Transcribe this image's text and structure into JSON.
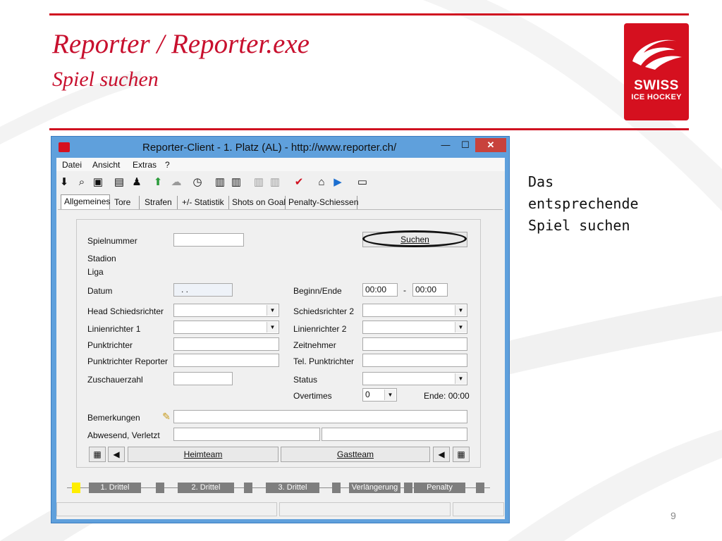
{
  "slide": {
    "title": "Reporter / Reporter.exe",
    "subtitle": "Spiel suchen",
    "note_lines": [
      "Das",
      "entsprechende",
      "Spiel suchen"
    ],
    "page_number": "9",
    "logo": {
      "line1": "SWISS",
      "line2": "ICE HOCKEY"
    },
    "accent_color": "#c8102e"
  },
  "window": {
    "title": "Reporter-Client  -  1. Platz (AL)  -  http://www.reporter.ch/",
    "controls": {
      "minimize": "—",
      "maximize": "☐",
      "close": "✕"
    }
  },
  "menu": [
    "Datei",
    "Ansicht",
    "Extras",
    "?"
  ],
  "toolbar_icons": [
    "download-icon",
    "search-icon",
    "save-icon",
    "clipboard-icon",
    "players-icon",
    "upload-icon",
    "cloud-icon",
    "stopwatch-icon",
    "lineup-icon",
    "lineup2-icon",
    "lineup-disabled-icon",
    "lineup2-disabled-icon",
    "checkmark-icon",
    "home-icon",
    "youtube-icon",
    "tv-icon"
  ],
  "tabs": [
    "Allgemeines",
    "Tore",
    "Strafen",
    "+/- Statistik",
    "Shots on Goal",
    "Penalty-Schiessen"
  ],
  "form": {
    "spielnummer_label": "Spielnummer",
    "spielnummer_value": "",
    "suchen_button": "Suchen",
    "stadion_label": "Stadion",
    "liga_label": "Liga",
    "datum_label": "Datum",
    "datum_value": ". .",
    "beginn_label": "Beginn/Ende",
    "beginn_value": "00:00",
    "range_sep": "-",
    "ende_value": "00:00",
    "head_label": "Head Schiedsrichter",
    "sr2_label": "Schiedsrichter 2",
    "lin1_label": "Linienrichter 1",
    "lin2_label": "Linienrichter 2",
    "punkt_label": "Punktrichter",
    "zeit_label": "Zeitnehmer",
    "punktrep_label": "Punktrichter Reporter",
    "tel_label": "Tel. Punktrichter",
    "zusch_label": "Zuschauerzahl",
    "status_label": "Status",
    "overtimes_label": "Overtimes",
    "overtimes_value": "0",
    "ende_label": "Ende: 00:00",
    "bemerkungen_label": "Bemerkungen",
    "abwesend_label": "Abwesend, Verletzt",
    "heimteam": "Heimteam",
    "gastteam": "Gastteam"
  },
  "periods": [
    "1. Drittel",
    "2. Drittel",
    "3. Drittel",
    "Verlängerung",
    "Penalty"
  ]
}
